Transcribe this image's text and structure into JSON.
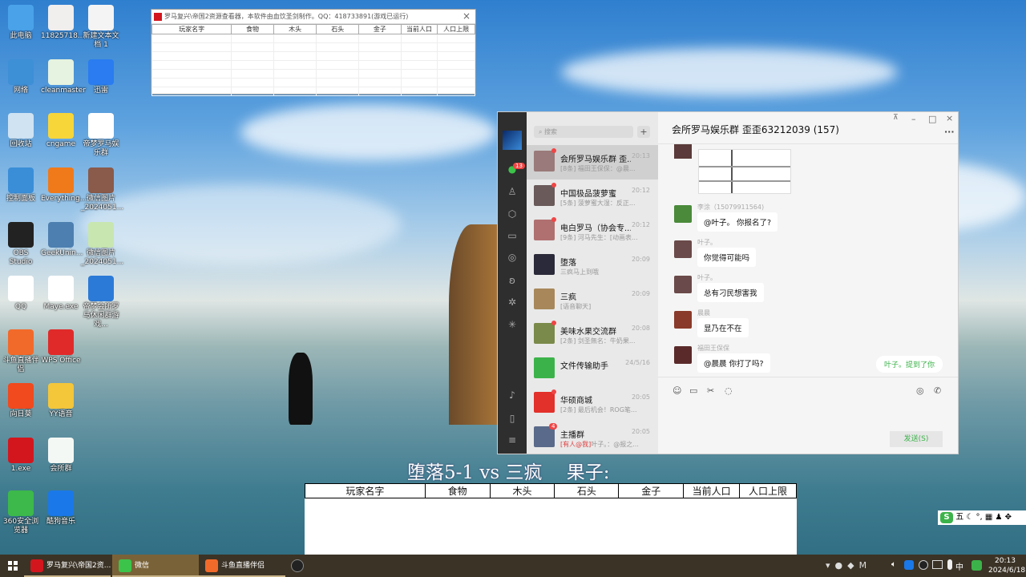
{
  "desktop": {
    "icons": [
      {
        "label": "此电脑",
        "color": "#4aa3e8"
      },
      {
        "label": "网络",
        "color": "#3d8fd6"
      },
      {
        "label": "回收站",
        "color": "#cfe3f2"
      },
      {
        "label": "控制面板",
        "color": "#3a8ed8"
      },
      {
        "label": "OBS Studio",
        "color": "#222222"
      },
      {
        "label": "QQ",
        "color": "#ffffff"
      },
      {
        "label": "斗鱼直播伴侣",
        "color": "#f26a2a"
      },
      {
        "label": "向日葵",
        "color": "#f04a1e"
      },
      {
        "label": "1.exe",
        "color": "#d3161e"
      },
      {
        "label": "360安全浏览器",
        "color": "#3cb94a"
      },
      {
        "label": "11825718...",
        "color": "#f1eeee"
      },
      {
        "label": "cleanmaster",
        "color": "#e6f3e0"
      },
      {
        "label": "cngame",
        "color": "#f7d63a"
      },
      {
        "label": "Everything...",
        "color": "#f07a1a"
      },
      {
        "label": "GeekUnin...",
        "color": "#4d7fb0"
      },
      {
        "label": "Maye.exe",
        "color": "#ffffff"
      },
      {
        "label": "WPS Office",
        "color": "#e02a2a"
      },
      {
        "label": "YY语音",
        "color": "#f4c63a"
      },
      {
        "label": "会所群",
        "color": "#f4f8f4"
      },
      {
        "label": "酷狗音乐",
        "color": "#1a78e8"
      },
      {
        "label": "新建文本文档 1",
        "color": "#f4f4f4"
      },
      {
        "label": "迅雷",
        "color": "#2a7cf0"
      },
      {
        "label": "帝梦罗马娱乐群",
        "color": "#ffffff"
      },
      {
        "label": "微信图片_2024051...",
        "color": "#8a5a4a"
      },
      {
        "label": "微信图片_2024051...",
        "color": "#c8e6b0"
      },
      {
        "label": "帝梦会所罗马休闲群游戏...",
        "color": "#2b7ad8"
      }
    ]
  },
  "tool_window": {
    "title": "罗马复兴\\帝国2资源查看器，本软件由血饮圣剑制作。QQ：418733891(游戏已运行)",
    "close": "×",
    "columns": [
      "玩家名字",
      "食物",
      "木头",
      "石头",
      "金子",
      "当前人口",
      "人口上限"
    ]
  },
  "wechat": {
    "search_placeholder": "搜索",
    "add": "+",
    "unread_badge": "13",
    "chats": [
      {
        "name": "会所罗马娱乐群 歪...",
        "time": "20:13",
        "preview": "[8条] 福田王保保：@晨...",
        "dot": true,
        "color": "#9a7a7a",
        "active": true
      },
      {
        "name": "中国极品菠萝蜜",
        "time": "20:12",
        "preview": "[5条] 菠萝蜜大湿：反正...",
        "dot": true,
        "color": "#6a5a5a"
      },
      {
        "name": "电白罗马（协会专...",
        "time": "20:12",
        "preview": "[9条] 河马先生：[动画表...",
        "dot": true,
        "color": "#b07070"
      },
      {
        "name": "堕落",
        "time": "20:09",
        "preview": "三疯马上到哦",
        "dot": false,
        "color": "#2a2a3a"
      },
      {
        "name": "三疯",
        "time": "20:09",
        "preview": "[语音聊天]",
        "dot": false,
        "color": "#a8885a"
      },
      {
        "name": "美味水果交流群",
        "time": "20:08",
        "preview": "[2条] 剑圣無名：牛奶果...",
        "dot": true,
        "color": "#7a8a4a"
      },
      {
        "name": "文件传输助手",
        "time": "24/5/16",
        "preview": "",
        "dot": false,
        "color": "#3cb34a"
      },
      {
        "name": "华硕商城",
        "time": "20:05",
        "preview": "[2条] 最后机会！ROG笔...",
        "dot": true,
        "color": "#e2302a"
      },
      {
        "name": "主播群",
        "time": "20:05",
        "preview": "叶子。：@报之...",
        "mention": "[有人@我]",
        "badge": "4",
        "color": "#5a6a8a"
      }
    ],
    "chat_title": "会所罗马娱乐群 歪歪63212039 (157)",
    "messages": [
      {
        "sender": "李涂（15079911564)",
        "text": "@叶子。 你报名了?",
        "color": "#4a8a3a"
      },
      {
        "sender": "叶子。",
        "text": "你觉得可能吗",
        "color": "#6a4a4a"
      },
      {
        "sender": "叶子。",
        "text": "总有刁民想害我",
        "color": "#6a4a4a"
      },
      {
        "sender": "晨晨",
        "text": "显乃在不在",
        "color": "#8a3a2a"
      },
      {
        "sender": "福田王保保",
        "text": "@晨晨 你打了吗?",
        "color": "#5a2a2a"
      }
    ],
    "mention_tip": "叶子。提到了你",
    "send": "发送(S)",
    "title_buttons": {
      "pin": "⊼",
      "min": "–",
      "max": "□",
      "close": "×",
      "more": "···"
    }
  },
  "overlay_text": "堕落5-1 vs 三疯　 果子:",
  "bottom_table": {
    "columns": [
      "玩家名字",
      "食物",
      "木头",
      "石头",
      "金子",
      "当前人口",
      "人口上限"
    ]
  },
  "ime": {
    "mode": "五"
  },
  "taskbar": {
    "items": [
      {
        "label": "罗马复兴\\帝国2资...",
        "color": "#d3161e"
      },
      {
        "label": "微信",
        "color": "#3cc34a",
        "active": true
      },
      {
        "label": "斗鱼直播伴侣",
        "color": "#f26a2a"
      }
    ],
    "tray_lang": "中",
    "time": "20:13",
    "date": "2024/6/18"
  }
}
